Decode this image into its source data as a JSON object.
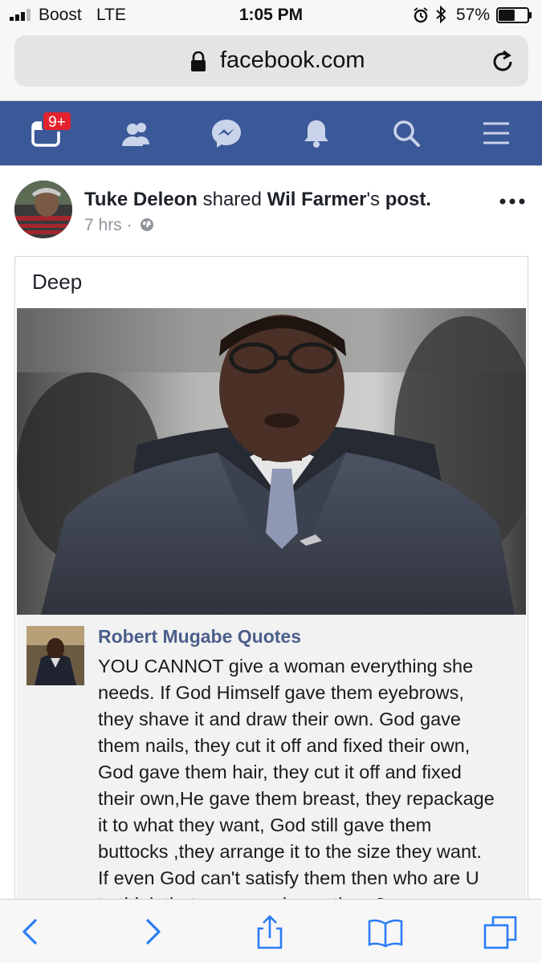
{
  "status_bar": {
    "carrier": "Boost",
    "network": "LTE",
    "time": "1:05 PM",
    "battery": "57%",
    "battery_level": 0.57
  },
  "browser": {
    "url": "facebook.com",
    "icons": [
      "lock-icon",
      "reload-icon"
    ]
  },
  "fb_nav": {
    "color": "#3b5998",
    "notification_badge": "9+",
    "items": [
      "feed-calendar-icon",
      "friends-icon",
      "messenger-icon",
      "notifications-bell-icon",
      "search-icon",
      "menu-icon"
    ]
  },
  "post": {
    "author": "Tuke Deleon",
    "shared_text": " shared ",
    "original_author": "Wil Farmer",
    "possessive": "'s ",
    "post_word": "post.",
    "time": "7 hrs",
    "separator": " · ",
    "shared_caption": "Deep",
    "quote": {
      "page_name": "Robert Mugabe Quotes",
      "text": "YOU CANNOT give a woman everything she\nneeds. If God Himself gave them eyebrows,\nthey shave it and draw their own. God gave\nthem nails, they cut it off and fixed their own,\nGod gave them hair, they cut it off and fixed\ntheir own,He gave them breast, they repackage\nit to what they want, God still gave them\nbuttocks ,they arrange it to the size they want.\nIf even God can't satisfy them then who are U\nto think that you can please them?"
    }
  },
  "toolbar": {
    "items": [
      "back-icon",
      "forward-icon",
      "share-icon",
      "bookmarks-icon",
      "tabs-icon"
    ],
    "tint": "#2a7cf6"
  }
}
